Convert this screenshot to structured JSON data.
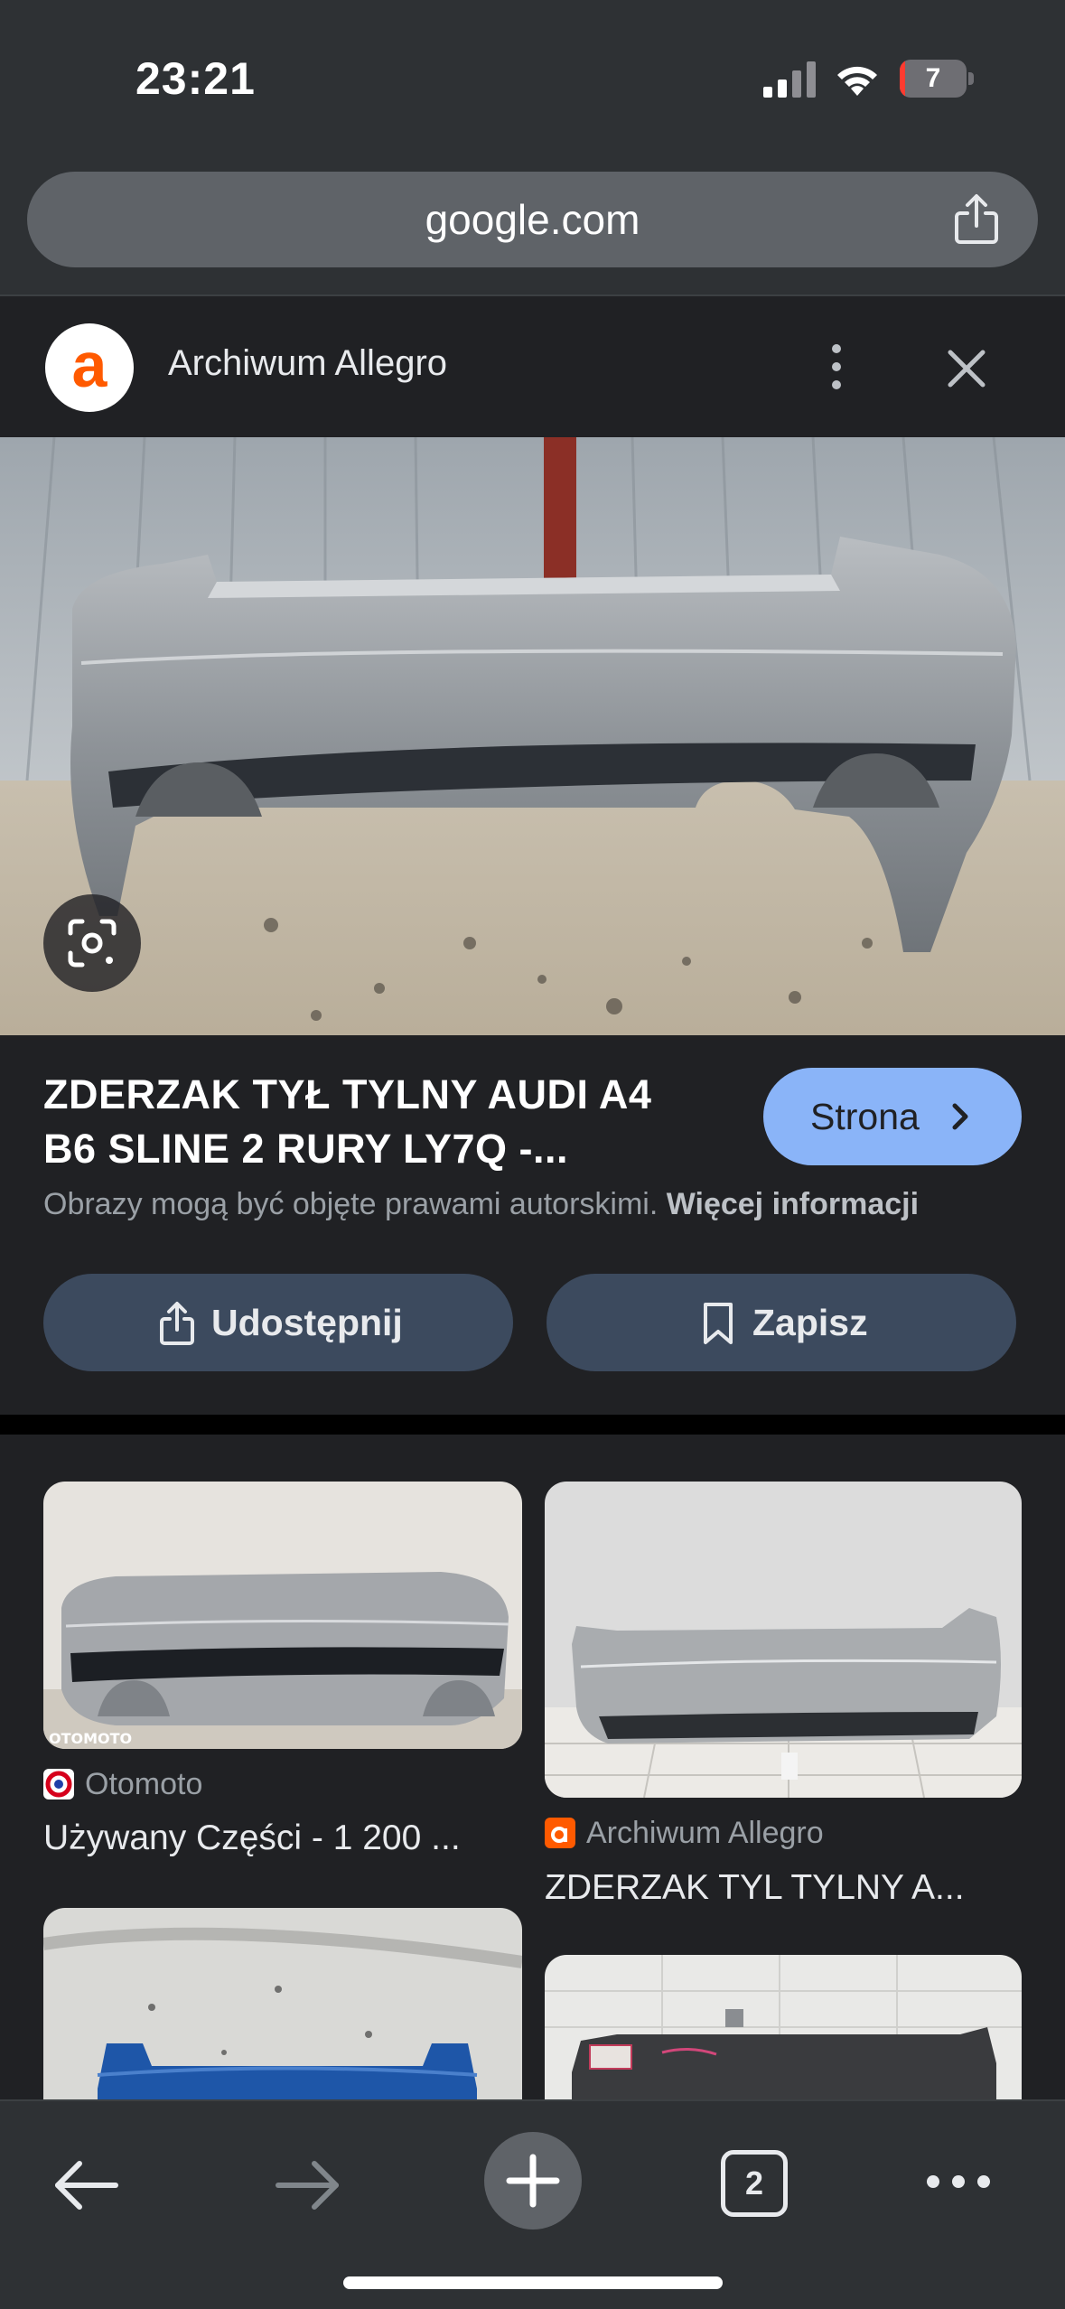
{
  "status_bar": {
    "time": "23:21",
    "battery": "7",
    "battery_level_pct": 7
  },
  "address_bar": {
    "url": "google.com"
  },
  "panel": {
    "site_name": "Archiwum Allegro",
    "logo_letter": "a"
  },
  "result": {
    "title_line1": "ZDERZAK TYŁ TYLNY AUDI A4",
    "title_line2": "B6 SLINE 2 RURY LY7Q -...",
    "visit_label": "Strona",
    "copyright_text": "Obrazy mogą być objęte prawami autorskimi.",
    "more_info": "Więcej informacji",
    "share_label": "Udostępnij",
    "save_label": "Zapisz"
  },
  "related": [
    {
      "source": "Otomoto",
      "title": "Używany Części - 1 200 ...",
      "watermark": "OTOMOTO",
      "favicon_color": "#d6001c"
    },
    {
      "source": "Archiwum Allegro",
      "title": "ZDERZAK TYL TYLNY A...",
      "favicon_color": "#ff5a00"
    }
  ],
  "toolbar": {
    "tab_count": "2"
  },
  "icons": [
    "signal-icon",
    "wifi-icon",
    "share-icon",
    "more-vert-icon",
    "close-icon",
    "lens-icon",
    "chevron-right-icon",
    "bookmark-icon",
    "back-arrow-icon",
    "forward-arrow-icon",
    "plus-icon",
    "more-horiz-icon"
  ],
  "colors": {
    "accent_button": "#8ab4f8",
    "background": "#202124",
    "action_button": "#3c4a5e"
  }
}
